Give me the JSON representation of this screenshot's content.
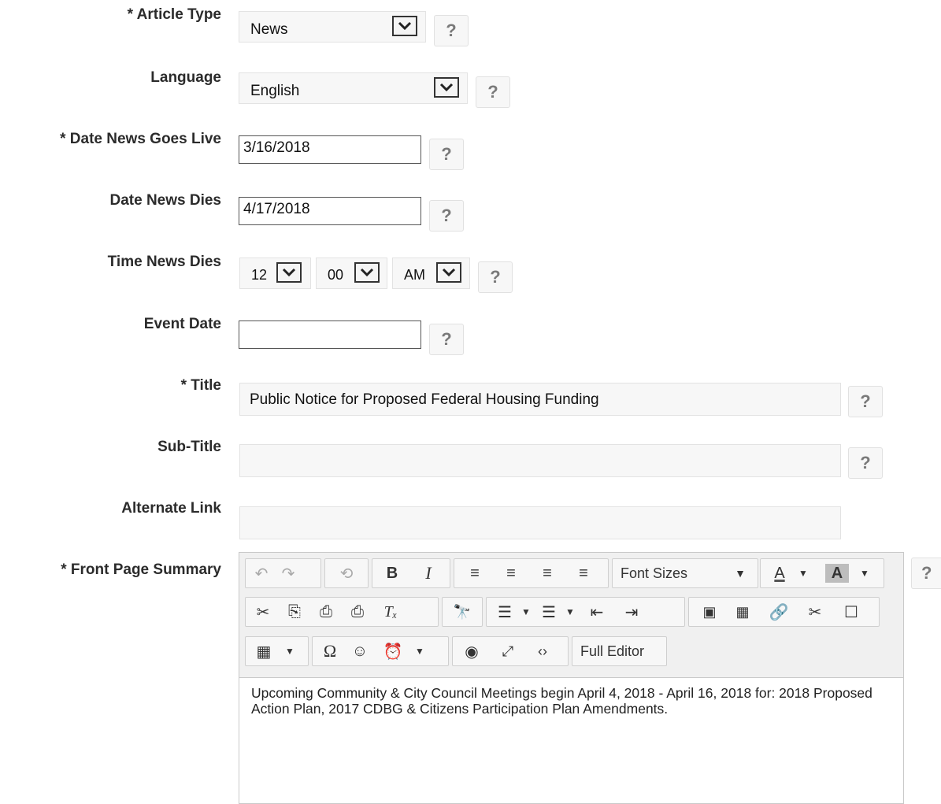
{
  "fields": {
    "article_type": {
      "label": "* Article Type",
      "value": "News"
    },
    "language": {
      "label": "Language",
      "value": "English"
    },
    "date_live": {
      "label": "* Date News Goes Live",
      "value": "3/16/2018"
    },
    "date_dies": {
      "label": "Date News Dies",
      "value": "4/17/2018"
    },
    "time_dies": {
      "label": "Time News Dies",
      "hour": "12",
      "minute": "00",
      "ampm": "AM"
    },
    "event_date": {
      "label": "Event Date",
      "value": ""
    },
    "title": {
      "label": "* Title",
      "value": "Public Notice for Proposed Federal Housing Funding"
    },
    "subtitle": {
      "label": "Sub-Title",
      "value": ""
    },
    "alternate_link": {
      "label": "Alternate Link",
      "value": ""
    },
    "summary": {
      "label": "* Front Page Summary"
    }
  },
  "help_label": "?",
  "editor": {
    "font_sizes_label": "Font Sizes",
    "full_editor_label": "Full Editor",
    "content": "Upcoming Community & City Council Meetings begin April 4, 2018 - April 16, 2018 for: 2018 Proposed Action Plan, 2017 CDBG & Citizens Participation Plan Amendments."
  }
}
